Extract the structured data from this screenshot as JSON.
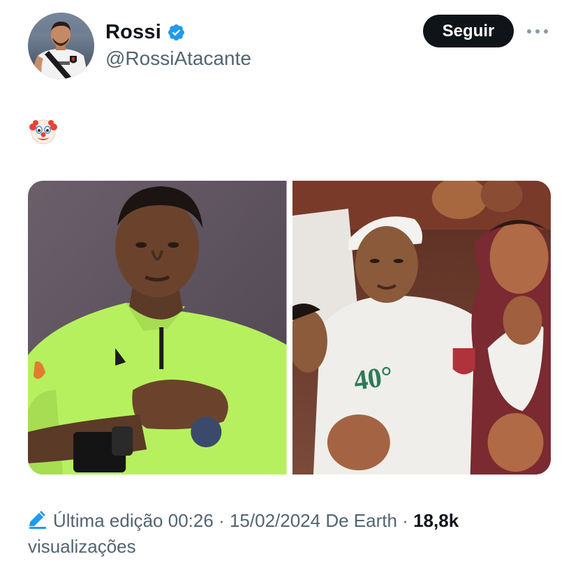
{
  "author": {
    "display_name": "Rossi",
    "handle": "@RossiAtacante",
    "avatar_icon": "avatar-player-photo",
    "verified_color": "#1d9bf0"
  },
  "header": {
    "follow_label": "Seguir",
    "more_icon": "more-horizontal-icon"
  },
  "tweet": {
    "text_emoji": "🤡",
    "media": [
      {
        "description_icon": "photo-referee"
      },
      {
        "description_icon": "photo-fans"
      }
    ]
  },
  "footer": {
    "edit_icon": "pencil-icon",
    "edit_label": "Última edição",
    "time": "00:26",
    "separator": "·",
    "date": "15/02/2024",
    "source": "De Earth",
    "views_count": "18,8k",
    "views_label": "visualizações"
  },
  "colors": {
    "button_bg": "#0f1419",
    "secondary_text": "#536471",
    "edit_icon": "#1d9bf0"
  }
}
